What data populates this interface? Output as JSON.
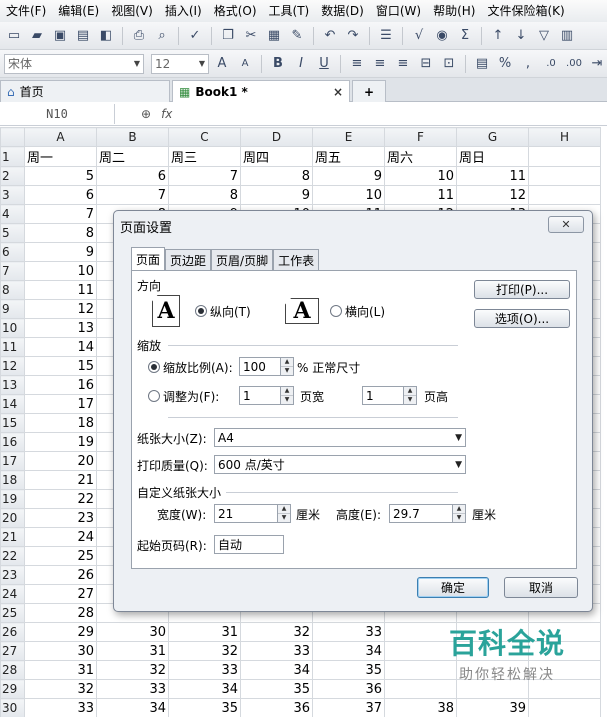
{
  "menu": [
    "文件(F)",
    "编辑(E)",
    "视图(V)",
    "插入(I)",
    "格式(O)",
    "工具(T)",
    "数据(D)",
    "窗口(W)",
    "帮助(H)",
    "文件保险箱(K)"
  ],
  "font_combo": {
    "name": "宋体",
    "size": "12"
  },
  "format_buttons": {
    "bold": "B",
    "italic": "I",
    "underline": "U",
    "percent": "%"
  },
  "tabs": [
    {
      "label": "首页",
      "close": ""
    },
    {
      "label": "Book1 *",
      "close": "×"
    }
  ],
  "new_tab": "+",
  "formula_bar": {
    "cell_ref": "N10",
    "fx": "fx"
  },
  "sheet": {
    "columns": [
      "A",
      "B",
      "C",
      "D",
      "E",
      "F",
      "G",
      "H"
    ],
    "rows": [
      {
        "n": "1",
        "cells": [
          "周一",
          "周二",
          "周三",
          "周四",
          "周五",
          "周六",
          "周日",
          ""
        ]
      },
      {
        "n": "2",
        "cells": [
          "5",
          "6",
          "7",
          "8",
          "9",
          "10",
          "11",
          ""
        ]
      },
      {
        "n": "3",
        "cells": [
          "6",
          "7",
          "8",
          "9",
          "10",
          "11",
          "12",
          ""
        ]
      },
      {
        "n": "4",
        "cells": [
          "7",
          "8",
          "9",
          "10",
          "11",
          "12",
          "13",
          ""
        ]
      },
      {
        "n": "5",
        "cells": [
          "8",
          "",
          "",
          "",
          "",
          "",
          "",
          ""
        ]
      },
      {
        "n": "6",
        "cells": [
          "9",
          "",
          "",
          "",
          "",
          "",
          "",
          ""
        ]
      },
      {
        "n": "7",
        "cells": [
          "10",
          "",
          "",
          "",
          "",
          "",
          "",
          ""
        ]
      },
      {
        "n": "8",
        "cells": [
          "11",
          "",
          "",
          "",
          "",
          "",
          "",
          ""
        ]
      },
      {
        "n": "9",
        "cells": [
          "12",
          "",
          "",
          "",
          "",
          "",
          "",
          ""
        ]
      },
      {
        "n": "10",
        "cells": [
          "13",
          "",
          "",
          "",
          "",
          "",
          "",
          ""
        ]
      },
      {
        "n": "11",
        "cells": [
          "14",
          "",
          "",
          "",
          "",
          "",
          "",
          ""
        ]
      },
      {
        "n": "12",
        "cells": [
          "15",
          "",
          "",
          "",
          "",
          "",
          "",
          ""
        ]
      },
      {
        "n": "13",
        "cells": [
          "16",
          "",
          "",
          "",
          "",
          "",
          "",
          ""
        ]
      },
      {
        "n": "14",
        "cells": [
          "17",
          "",
          "",
          "",
          "",
          "",
          "",
          ""
        ]
      },
      {
        "n": "15",
        "cells": [
          "18",
          "",
          "",
          "",
          "",
          "",
          "",
          ""
        ]
      },
      {
        "n": "16",
        "cells": [
          "19",
          "",
          "",
          "",
          "",
          "",
          "",
          ""
        ]
      },
      {
        "n": "17",
        "cells": [
          "20",
          "",
          "",
          "",
          "",
          "",
          "",
          ""
        ]
      },
      {
        "n": "18",
        "cells": [
          "21",
          "",
          "",
          "",
          "",
          "",
          "",
          ""
        ]
      },
      {
        "n": "19",
        "cells": [
          "22",
          "",
          "",
          "",
          "",
          "",
          "",
          ""
        ]
      },
      {
        "n": "20",
        "cells": [
          "23",
          "",
          "",
          "",
          "",
          "",
          "",
          ""
        ]
      },
      {
        "n": "21",
        "cells": [
          "24",
          "",
          "",
          "",
          "",
          "",
          "",
          ""
        ]
      },
      {
        "n": "22",
        "cells": [
          "25",
          "",
          "",
          "",
          "",
          "",
          "",
          ""
        ]
      },
      {
        "n": "23",
        "cells": [
          "26",
          "",
          "",
          "",
          "",
          "",
          "",
          ""
        ]
      },
      {
        "n": "24",
        "cells": [
          "27",
          "",
          "",
          "",
          "",
          "",
          "",
          ""
        ]
      },
      {
        "n": "25",
        "cells": [
          "28",
          "",
          "",
          "",
          "",
          "",
          "",
          ""
        ]
      },
      {
        "n": "26",
        "cells": [
          "29",
          "30",
          "31",
          "32",
          "33",
          "",
          "",
          ""
        ]
      },
      {
        "n": "27",
        "cells": [
          "30",
          "31",
          "32",
          "33",
          "34",
          "",
          "",
          ""
        ]
      },
      {
        "n": "28",
        "cells": [
          "31",
          "32",
          "33",
          "34",
          "35",
          "",
          "",
          ""
        ]
      },
      {
        "n": "29",
        "cells": [
          "32",
          "33",
          "34",
          "35",
          "36",
          "",
          "",
          ""
        ]
      },
      {
        "n": "30",
        "cells": [
          "33",
          "34",
          "35",
          "36",
          "37",
          "38",
          "39",
          ""
        ]
      }
    ]
  },
  "dialog": {
    "title": "页面设置",
    "close": "✕",
    "tabs": [
      "页面",
      "页边距",
      "页眉/页脚",
      "工作表"
    ],
    "orientation": {
      "label": "方向",
      "portrait": "纵向(T)",
      "landscape": "横向(L)",
      "portrait_icon": "A",
      "landscape_icon": "A",
      "selected": "portrait"
    },
    "buttons": {
      "print": "打印(P)...",
      "options": "选项(O)...",
      "ok": "确定",
      "cancel": "取消"
    },
    "scaling": {
      "label": "缩放",
      "adjust_label": "缩放比例(A):",
      "adjust_value": "100",
      "adjust_suffix": "% 正常尺寸",
      "fit_label": "调整为(F):",
      "fit_wide_value": "1",
      "fit_wide_suffix": "页宽",
      "fit_tall_value": "1",
      "fit_tall_suffix": "页高",
      "selected": "adjust"
    },
    "paper_size": {
      "label": "纸张大小(Z):",
      "value": "A4"
    },
    "print_quality": {
      "label": "打印质量(Q):",
      "value": "600 点/英寸"
    },
    "custom_size": {
      "label": "自定义纸张大小",
      "width_label": "宽度(W):",
      "width_value": "21",
      "width_unit": "厘米",
      "height_label": "高度(E):",
      "height_value": "29.7",
      "height_unit": "厘米"
    },
    "first_page": {
      "label": "起始页码(R):",
      "value": "自动"
    }
  },
  "watermark": {
    "main": "百科全说",
    "sub": "助你轻松解决"
  },
  "colors": {
    "watermark": "#2aa39a",
    "accent": "#3c7fb1"
  }
}
